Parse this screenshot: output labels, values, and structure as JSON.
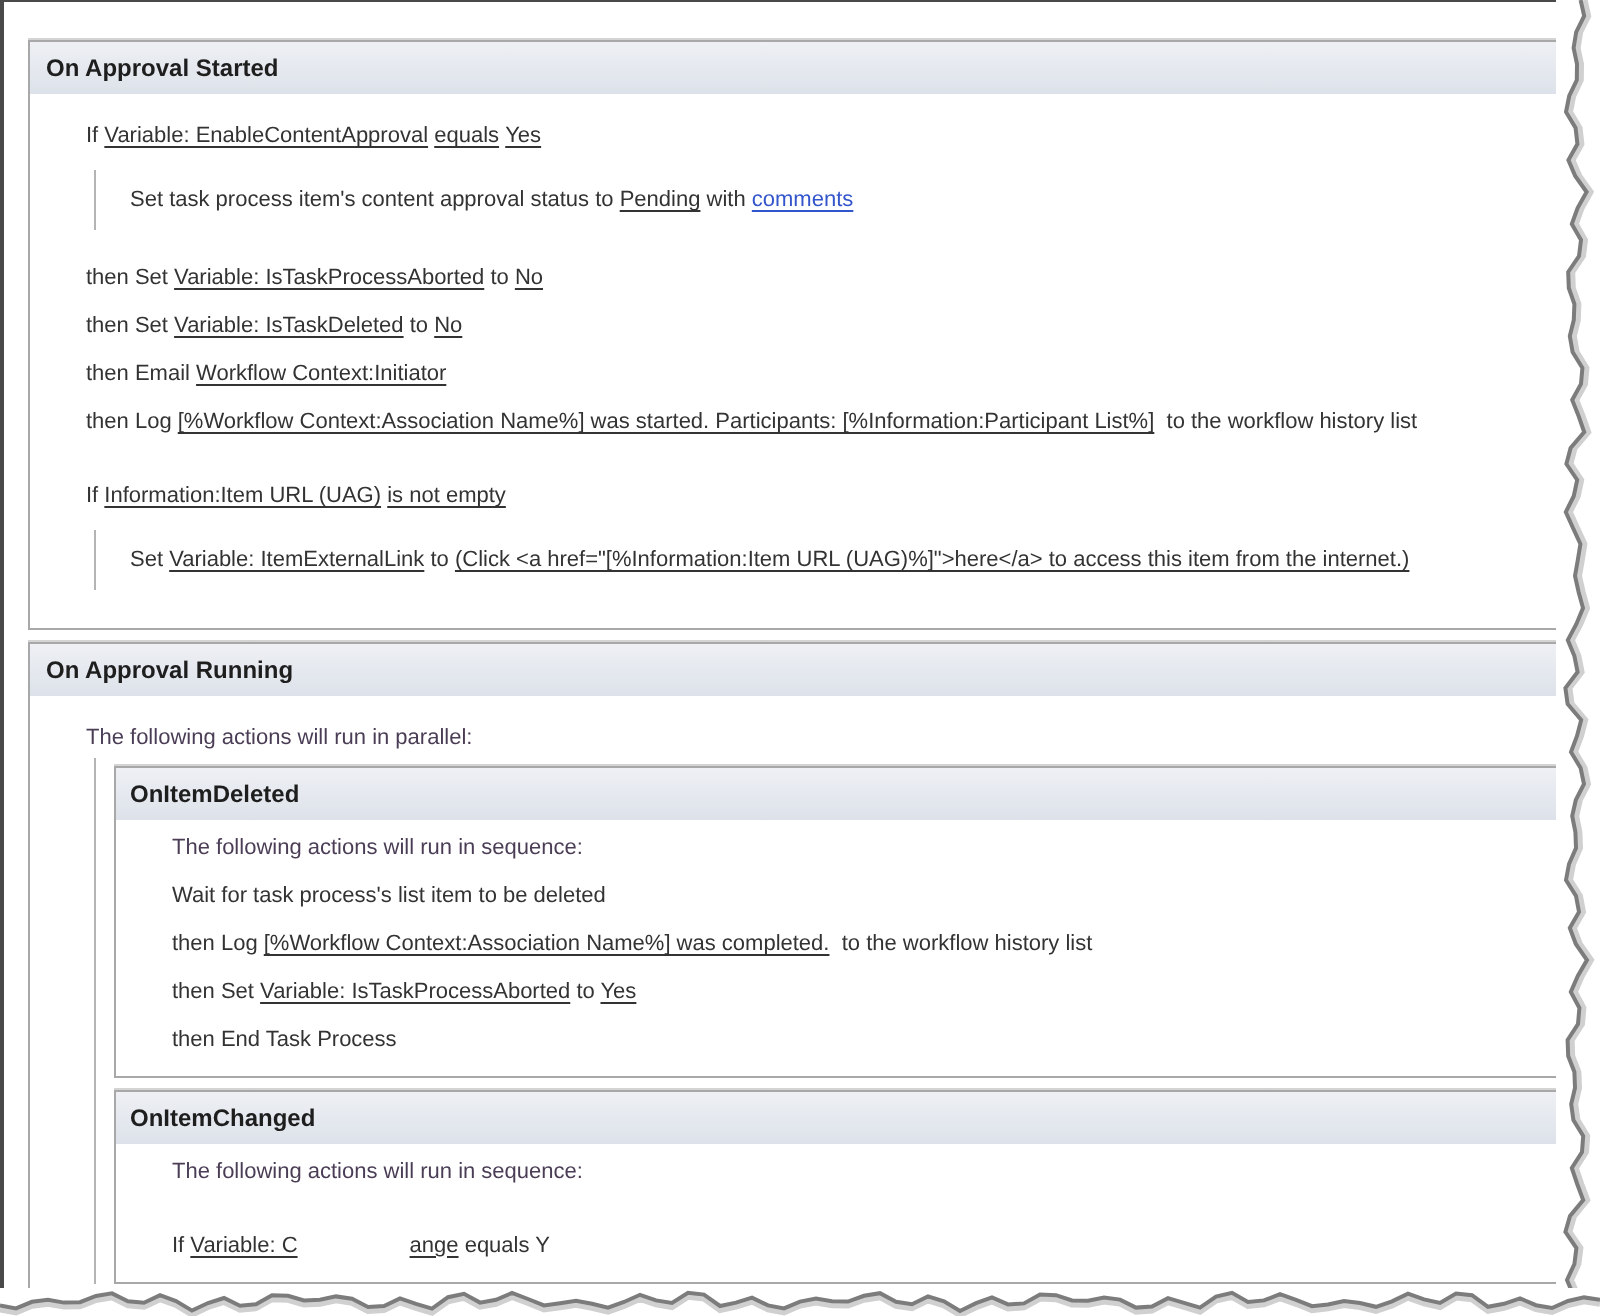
{
  "sections": [
    {
      "title": "On Approval Started",
      "items": [
        {
          "kind": "condition",
          "segments": [
            {
              "kind": "text",
              "text": "If "
            },
            {
              "kind": "value",
              "text": "Variable: EnableContentApproval"
            },
            {
              "kind": "value",
              "text": "equals"
            },
            {
              "kind": "value",
              "text": "Yes"
            }
          ]
        },
        {
          "kind": "block",
          "items": [
            {
              "kind": "action",
              "segments": [
                {
                  "kind": "text",
                  "text": "Set task process item's content approval status to "
                },
                {
                  "kind": "value",
                  "text": "Pending"
                },
                {
                  "kind": "text",
                  "text": " with "
                },
                {
                  "kind": "link",
                  "text": "comments"
                }
              ]
            }
          ]
        },
        {
          "kind": "action",
          "segments": [
            {
              "kind": "text",
              "text": "then Set "
            },
            {
              "kind": "value",
              "text": "Variable: IsTaskProcessAborted"
            },
            {
              "kind": "text",
              "text": " to "
            },
            {
              "kind": "value",
              "text": "No"
            }
          ]
        },
        {
          "kind": "action",
          "segments": [
            {
              "kind": "text",
              "text": "then Set "
            },
            {
              "kind": "value",
              "text": "Variable: IsTaskDeleted"
            },
            {
              "kind": "text",
              "text": " to "
            },
            {
              "kind": "value",
              "text": "No"
            }
          ]
        },
        {
          "kind": "action",
          "segments": [
            {
              "kind": "text",
              "text": "then Email "
            },
            {
              "kind": "value",
              "text": "Workflow Context:Initiator"
            }
          ]
        },
        {
          "kind": "action",
          "segments": [
            {
              "kind": "text",
              "text": "then Log "
            },
            {
              "kind": "value",
              "text": "[%Workflow Context:Association Name%] was started. Participants: [%Information:Participant List%]"
            },
            {
              "kind": "text",
              "text": "  to the workflow history list"
            }
          ]
        },
        {
          "kind": "condition",
          "segments": [
            {
              "kind": "text",
              "text": "If "
            },
            {
              "kind": "value",
              "text": "Information:Item URL (UAG)"
            },
            {
              "kind": "value",
              "text": "is not empty"
            }
          ]
        },
        {
          "kind": "block",
          "items": [
            {
              "kind": "action",
              "segments": [
                {
                  "kind": "text",
                  "text": "Set "
                },
                {
                  "kind": "value",
                  "text": "Variable: ItemExternalLink"
                },
                {
                  "kind": "text",
                  "text": " to "
                },
                {
                  "kind": "value",
                  "text": "(Click <a href=\"[%Information:Item URL (UAG)%]\">here</a> to access this item from the internet.)"
                }
              ]
            }
          ]
        }
      ]
    },
    {
      "title": "On Approval Running",
      "items": [
        {
          "kind": "note",
          "text": "The following actions will run in parallel:"
        },
        {
          "kind": "parallel",
          "branches": [
            {
              "title": "OnItemDeleted",
              "items": [
                {
                  "kind": "note",
                  "text": "The following actions will run in sequence:"
                },
                {
                  "kind": "action",
                  "segments": [
                    {
                      "kind": "text",
                      "text": "Wait for task process's list item to be deleted"
                    }
                  ]
                },
                {
                  "kind": "action",
                  "segments": [
                    {
                      "kind": "text",
                      "text": "then Log "
                    },
                    {
                      "kind": "value",
                      "text": "[%Workflow Context:Association Name%] was completed."
                    },
                    {
                      "kind": "text",
                      "text": "  to the workflow history list"
                    }
                  ]
                },
                {
                  "kind": "action",
                  "segments": [
                    {
                      "kind": "text",
                      "text": "then Set "
                    },
                    {
                      "kind": "value",
                      "text": "Variable: IsTaskProcessAborted"
                    },
                    {
                      "kind": "text",
                      "text": " to "
                    },
                    {
                      "kind": "value",
                      "text": "Yes"
                    }
                  ]
                },
                {
                  "kind": "action",
                  "segments": [
                    {
                      "kind": "text",
                      "text": "then End Task Process"
                    }
                  ]
                }
              ]
            },
            {
              "title": "OnItemChanged",
              "items": [
                {
                  "kind": "note",
                  "text": "The following actions will run in sequence:"
                },
                {
                  "kind": "torn",
                  "fragments": [
                    [
                      {
                        "kind": "text",
                        "text": "If "
                      },
                      {
                        "kind": "value",
                        "text": "Variable: C"
                      }
                    ],
                    [
                      {
                        "kind": "value",
                        "text": "ange"
                      },
                      {
                        "kind": "text",
                        "text": " equals Y"
                      }
                    ]
                  ]
                }
              ]
            }
          ]
        }
      ]
    }
  ]
}
